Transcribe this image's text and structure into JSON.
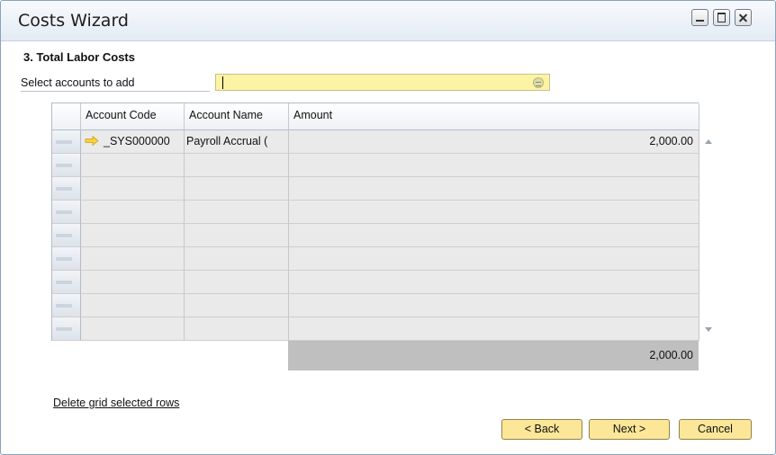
{
  "window": {
    "title": "Costs Wizard"
  },
  "section": {
    "title": "3. Total Labor Costs"
  },
  "select": {
    "label": "Select accounts to add",
    "value": ""
  },
  "grid": {
    "columns": [
      "Account Code",
      "Account Name",
      "Amount"
    ],
    "rows": [
      {
        "code": "_SYS000000",
        "name": "Payroll Accrual (",
        "amount": "2,000.00"
      },
      {
        "code": "",
        "name": "",
        "amount": ""
      },
      {
        "code": "",
        "name": "",
        "amount": ""
      },
      {
        "code": "",
        "name": "",
        "amount": ""
      },
      {
        "code": "",
        "name": "",
        "amount": ""
      },
      {
        "code": "",
        "name": "",
        "amount": ""
      },
      {
        "code": "",
        "name": "",
        "amount": ""
      },
      {
        "code": "",
        "name": "",
        "amount": ""
      },
      {
        "code": "",
        "name": "",
        "amount": ""
      }
    ],
    "total": "2,000.00"
  },
  "actions": {
    "delete_link": "Delete grid selected rows",
    "back": "< Back",
    "next": "Next >",
    "cancel": "Cancel"
  },
  "colors": {
    "field_yellow": "#fdf3a4",
    "button_yellow": "#fbe797",
    "total_gray": "#bfbfbf",
    "row_gray": "#eaeaea"
  }
}
